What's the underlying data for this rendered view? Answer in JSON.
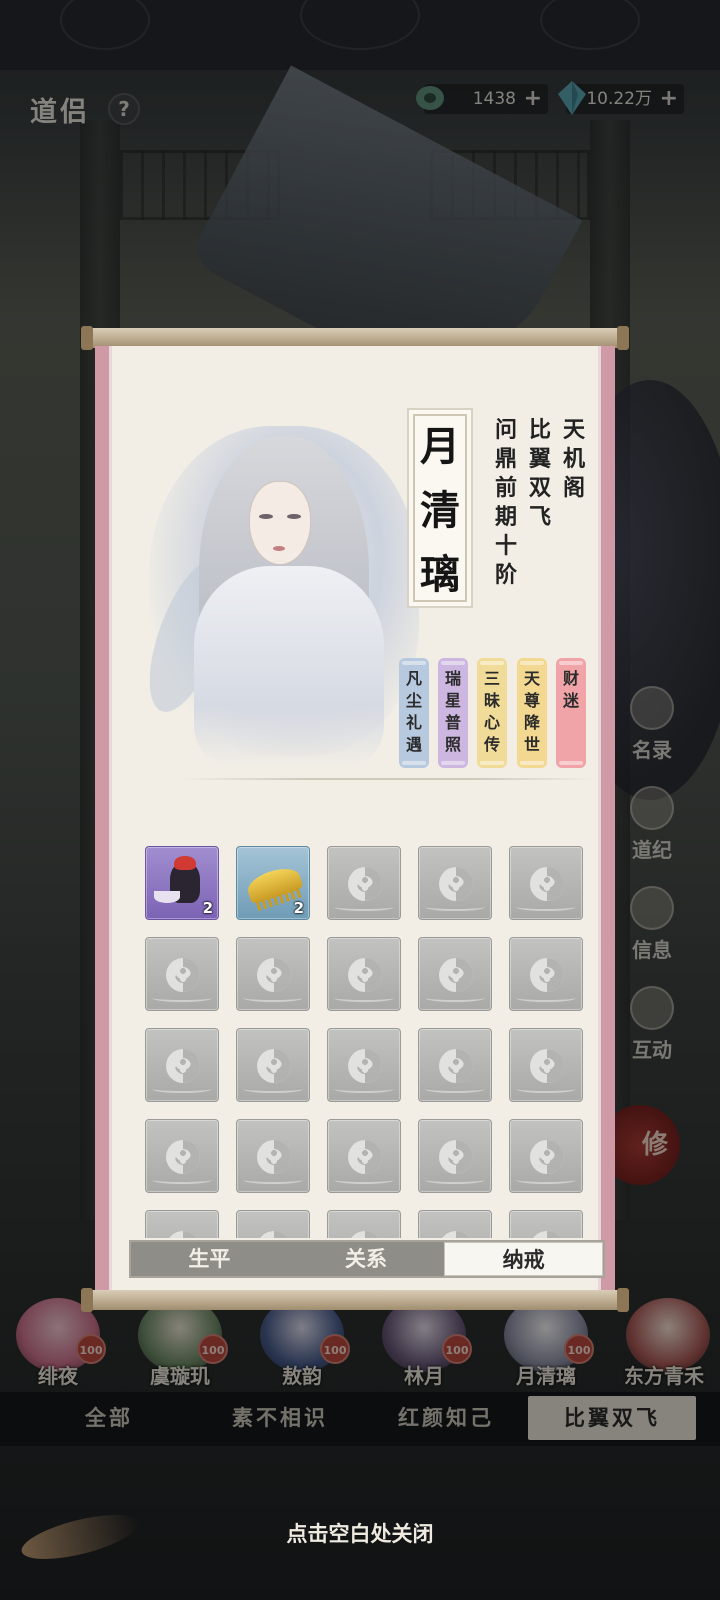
{
  "header": {
    "title": "道侣",
    "help_label": "?",
    "currencies": [
      {
        "icon": "jade-gem-icon",
        "value": "1438",
        "plus": "+"
      },
      {
        "icon": "spirit-stone-icon",
        "value": "10.22万",
        "plus": "+"
      }
    ]
  },
  "side_menu": [
    "名录",
    "道纪",
    "信息",
    "互动"
  ],
  "cultivate_label": "修",
  "companion": {
    "name_chars": [
      "月",
      "清",
      "璃"
    ],
    "sect": "天机阁",
    "relation": "比翼双飞",
    "realm": "问鼎前期十阶",
    "traits": [
      {
        "label": "凡尘礼遇",
        "color": "#b7c9df"
      },
      {
        "label": "瑞星普照",
        "color": "#cdb7e0"
      },
      {
        "label": "三昧心传",
        "color": "#f0dc98"
      },
      {
        "label": "天尊降世",
        "color": "#f2d890"
      },
      {
        "label": "财迷",
        "color": "#f0a4a8"
      }
    ]
  },
  "inventory": {
    "items": [
      {
        "icon": "wine-jar-icon",
        "count": "2",
        "rarity": "purple"
      },
      {
        "icon": "golden-comb-icon",
        "count": "2",
        "rarity": "blue"
      }
    ]
  },
  "tabs": [
    {
      "label": "生平",
      "active": false
    },
    {
      "label": "关系",
      "active": false
    },
    {
      "label": "纳戒",
      "active": true
    }
  ],
  "roster": [
    {
      "name": "绯夜",
      "level": "100",
      "color": "#c9708a"
    },
    {
      "name": "虞璇玑",
      "level": "100",
      "color": "#6d8a66"
    },
    {
      "name": "敖韵",
      "level": "100",
      "color": "#4a5d8c"
    },
    {
      "name": "林月",
      "level": "100",
      "color": "#6a5b7a"
    },
    {
      "name": "月清璃",
      "level": "100",
      "color": "#8b8fa3"
    },
    {
      "name": "东方青禾",
      "level": "",
      "color": "#a85a56"
    }
  ],
  "filters": [
    {
      "label": "全部",
      "active": false
    },
    {
      "label": "素不相识",
      "active": false
    },
    {
      "label": "红颜知己",
      "active": false
    },
    {
      "label": "比翼双飞",
      "active": true
    }
  ],
  "close_hint": "点击空白处关闭"
}
